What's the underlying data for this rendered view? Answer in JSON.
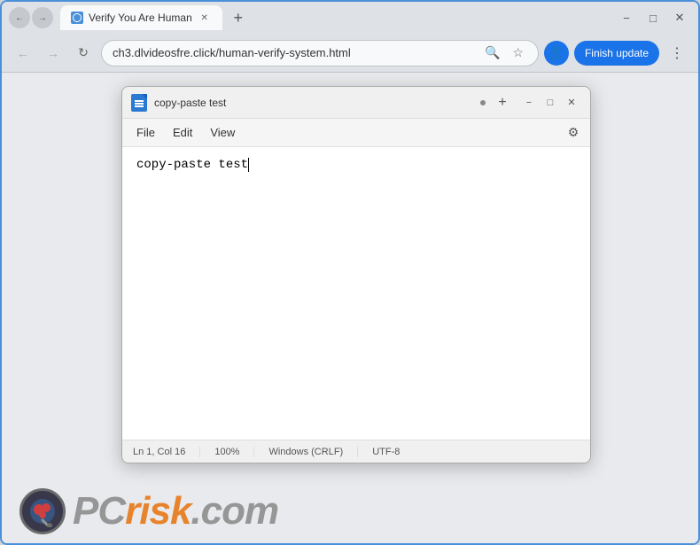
{
  "browser": {
    "tab": {
      "title": "Verify You Are Human",
      "favicon_alt": "tab-favicon"
    },
    "new_tab_label": "+",
    "window_controls": {
      "minimize": "−",
      "maximize": "□",
      "close": "✕"
    },
    "address_bar": {
      "back_btn": "←",
      "forward_btn": "→",
      "refresh_btn": "↻",
      "url": "ch3.dlvideosfre.click/human-verify-system.html",
      "search_icon": "🔍",
      "bookmark_icon": "☆",
      "profile_icon": "👤"
    },
    "finish_update_label": "Finish update",
    "more_menu": "⋮"
  },
  "notepad": {
    "title": "copy-paste test",
    "dot_indicator": "●",
    "new_tab_btn": "+",
    "win_controls": {
      "minimize": "−",
      "maximize": "□",
      "close": "✕"
    },
    "menu": {
      "file": "File",
      "edit": "Edit",
      "view": "View"
    },
    "editor_content": "copy-paste test",
    "status": {
      "position": "Ln 1, Col 16",
      "zoom": "100%",
      "line_ending": "Windows (CRLF)",
      "encoding": "UTF-8"
    }
  },
  "watermark": {
    "text_grey": "PC",
    "text_orange": "risk",
    "text_suffix": ".com"
  }
}
